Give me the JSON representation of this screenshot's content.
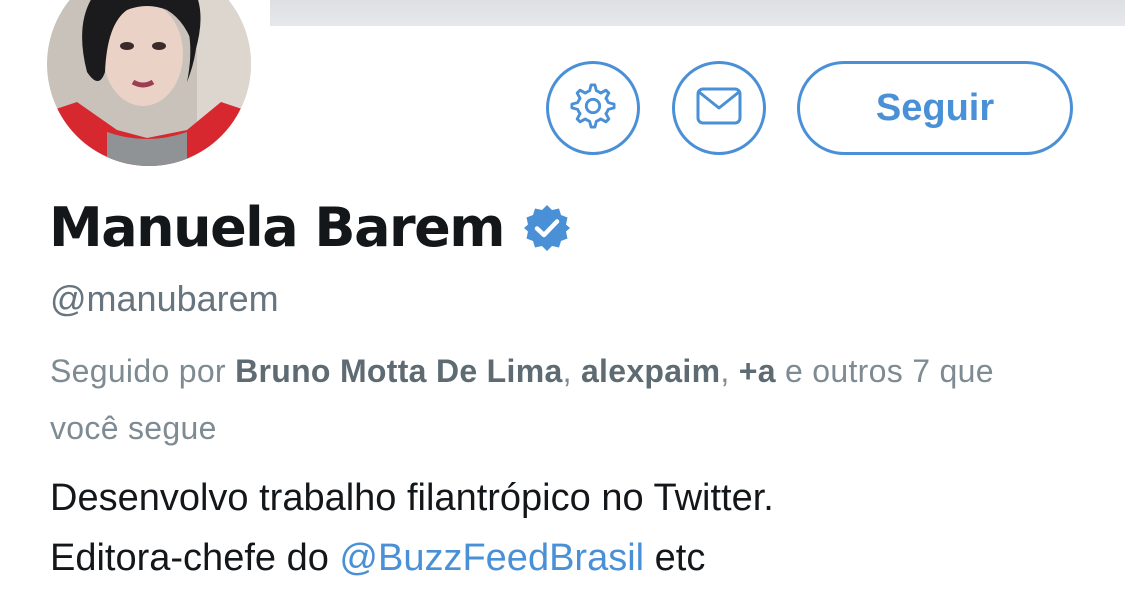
{
  "profile": {
    "name": "Manuela Barem",
    "handle": "@manubarem",
    "verified": true,
    "avatar_icon": "profile-photo"
  },
  "actions": {
    "settings_icon": "gear-icon",
    "message_icon": "envelope-icon",
    "follow_label": "Seguir"
  },
  "followed_by": {
    "prefix": "Seguido por ",
    "user_1": "Bruno Motta De Lima",
    "sep_1": ", ",
    "user_2": "alexpaim",
    "sep_2": ", ",
    "user_3": "+a",
    "suffix": " e outros 7 que você segue"
  },
  "bio": {
    "line_1": "Desenvolvo trabalho filantrópico no Twitter.",
    "line_2_prefix": "Editora-chefe do ",
    "mention": "@BuzzFeedBrasil",
    "line_2_suffix": " etc"
  },
  "colors": {
    "accent": "#4a90d6",
    "text": "#14171a",
    "secondary_text": "#66757f",
    "verified_badge": "#4a90d6"
  }
}
